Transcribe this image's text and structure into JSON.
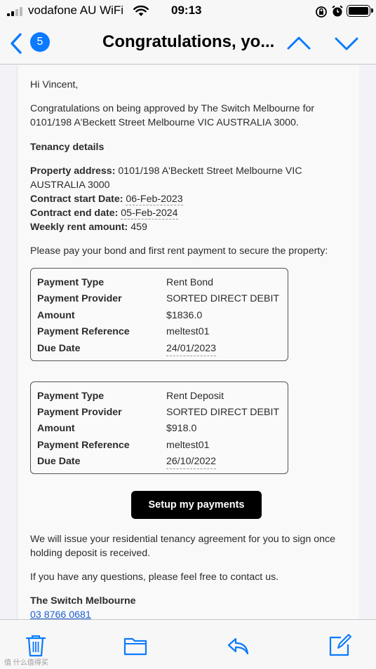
{
  "status_bar": {
    "carrier": "vodafone AU WiFi",
    "time": "09:13"
  },
  "nav": {
    "unread_count": "5",
    "title": "Congratulations, yo..."
  },
  "email": {
    "greeting": "Hi Vincent,",
    "intro_line1": "Congratulations on being approved by The Switch Melbourne for",
    "intro_line2": "0101/198 A'Beckett Street Melbourne VIC AUSTRALIA 3000.",
    "tenancy_heading": "Tenancy details",
    "property_label": "Property address:",
    "property_value_line1": "0101/198 A'Beckett Street Melbourne VIC",
    "property_value_line2": "AUSTRALIA 3000",
    "start_label": "Contract start Date:",
    "start_value": "06-Feb-2023",
    "end_label": "Contract end date:",
    "end_value": "05-Feb-2024",
    "rent_label": "Weekly rent amount:",
    "rent_value": "459",
    "pay_prompt": "Please pay your bond and first rent payment to secure the property:",
    "payments": [
      {
        "type_label": "Payment Type",
        "type_value": "Rent Bond",
        "provider_label": "Payment Provider",
        "provider_value": "SORTED DIRECT DEBIT",
        "amount_label": "Amount",
        "amount_value": "$1836.0",
        "reference_label": "Payment Reference",
        "reference_value": "meltest01",
        "due_label": "Due Date",
        "due_value": "24/01/2023"
      },
      {
        "type_label": "Payment Type",
        "type_value": "Rent Deposit",
        "provider_label": "Payment Provider",
        "provider_value": "SORTED DIRECT DEBIT",
        "amount_label": "Amount",
        "amount_value": "$918.0",
        "reference_label": "Payment Reference",
        "reference_value": "meltest01",
        "due_label": "Due Date",
        "due_value": "26/10/2022"
      }
    ],
    "cta_label": "Setup my payments",
    "agreement_line1": "We will issue your residential tenancy agreement for you to sign once",
    "agreement_line2": "holding deposit is received.",
    "questions": "If you have any questions, please feel free to contact us.",
    "signature": "The Switch Melbourne",
    "phone": "03 8766 0681"
  },
  "toolbar": {
    "watermark": "值 什么值得买"
  },
  "colors": {
    "accent": "#0a7aff",
    "cta_bg": "#000000",
    "link": "#1a5fd0"
  },
  "icons": [
    "back-chevron-icon",
    "wifi-icon",
    "rotation-lock-icon",
    "alarm-icon",
    "battery-icon",
    "chevron-up-icon",
    "chevron-down-icon",
    "trash-icon",
    "folder-icon",
    "reply-icon",
    "compose-icon"
  ]
}
